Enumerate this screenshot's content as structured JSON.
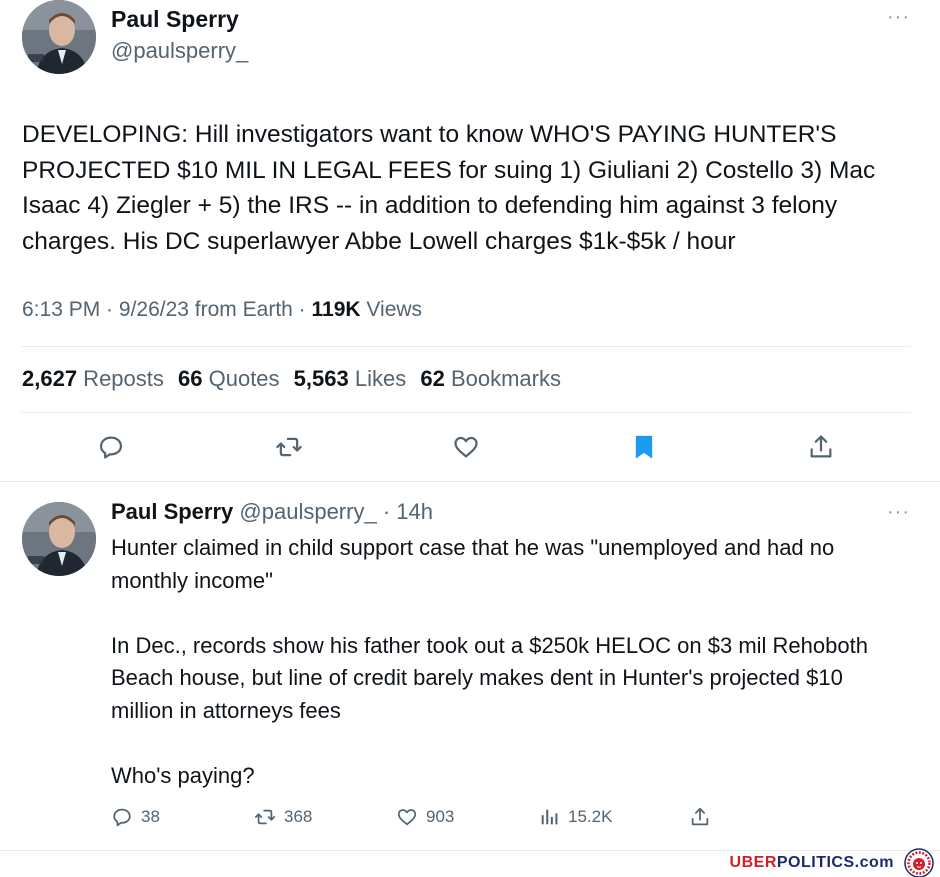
{
  "main_tweet": {
    "name": "Paul Sperry",
    "handle": "@paulsperry_",
    "more": "···",
    "text": "DEVELOPING: Hill investigators want to know WHO'S PAYING HUNTER'S PROJECTED $10 MIL IN LEGAL FEES for suing 1) Giuliani 2) Costello 3) Mac Isaac 4) Ziegler + 5) the IRS -- in addition to defending him against 3 felony charges. His DC superlawyer Abbe Lowell charges $1k-$5k / hour",
    "time": "6:13 PM",
    "dot": " · ",
    "date": "9/26/23",
    "source": " from Earth",
    "views_count": "119K",
    "views_label": " Views",
    "stats": {
      "reposts_count": "2,627",
      "reposts_label": " Reposts",
      "quotes_count": "66",
      "quotes_label": " Quotes",
      "likes_count": "5,563",
      "likes_label": " Likes",
      "bookmarks_count": "62",
      "bookmarks_label": " Bookmarks"
    },
    "actions": {
      "reply_icon": "speech-bubble",
      "repost_icon": "repost-arrows",
      "like_icon": "heart-outline",
      "bookmark_icon": "bookmark-filled",
      "share_icon": "share-upload"
    }
  },
  "reply": {
    "name": "Paul Sperry",
    "handle": "@paulsperry_",
    "time": " · 14h",
    "more": "···",
    "text": "Hunter claimed in child support case that he was \"unemployed and had no monthly income\"\n\nIn Dec., records show his father took out a $250k HELOC on $3 mil Rehoboth Beach house, but line of credit barely makes dent in Hunter's projected $10 million in attorneys fees\n\nWho's paying?",
    "replies": "38",
    "reposts": "368",
    "likes": "903",
    "views": "15.2K"
  },
  "footer": {
    "brand_part1": "UBER",
    "brand_part2": "POLITICS.com"
  },
  "colors": {
    "text": "#0f1419",
    "secondary": "#536471",
    "accent": "#1d9bf0",
    "divider": "#e6ecf0",
    "brand_red": "#d11f2a",
    "brand_navy": "#1a2a6c"
  }
}
